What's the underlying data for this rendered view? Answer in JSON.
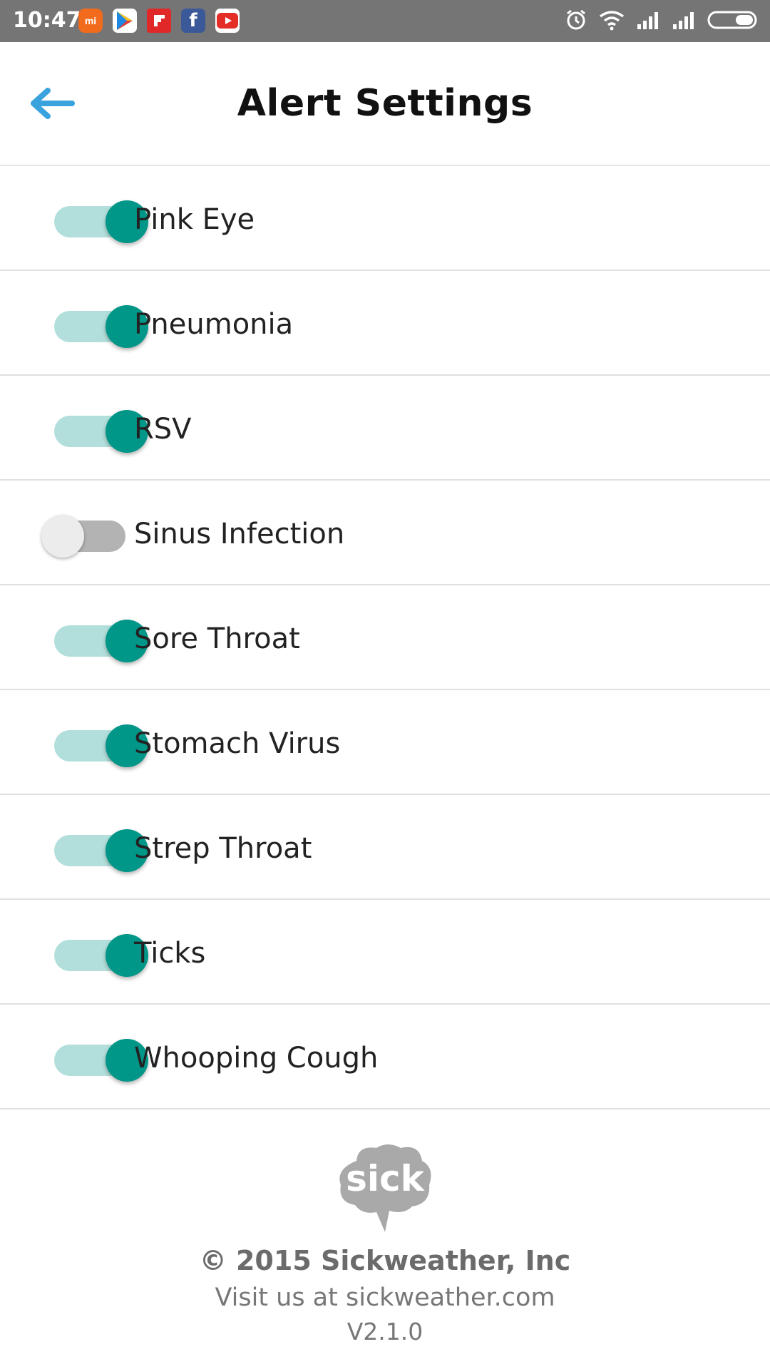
{
  "status_bar": {
    "time": "10:47",
    "notification_icons": [
      "mi-icon",
      "play-store-icon",
      "flipboard-icon",
      "facebook-icon",
      "youtube-icon"
    ],
    "system_icons": [
      "alarm-icon",
      "wifi-icon",
      "signal-icon",
      "signal-icon",
      "battery-icon"
    ]
  },
  "header": {
    "title": "Alert Settings",
    "back_icon": "arrow-left-icon",
    "accent_color": "#3aa3dd"
  },
  "alerts": [
    {
      "label": "Pink Eye",
      "enabled": true
    },
    {
      "label": "Pneumonia",
      "enabled": true
    },
    {
      "label": "RSV",
      "enabled": true
    },
    {
      "label": "Sinus Infection",
      "enabled": false
    },
    {
      "label": "Sore Throat",
      "enabled": true
    },
    {
      "label": "Stomach Virus",
      "enabled": true
    },
    {
      "label": "Strep Throat",
      "enabled": true
    },
    {
      "label": "Ticks",
      "enabled": true
    },
    {
      "label": "Whooping Cough",
      "enabled": true
    }
  ],
  "footer": {
    "logo_text": "sick",
    "copyright": "© 2015 Sickweather, Inc",
    "visit": "Visit us at sickweather.com",
    "version": "V2.1.0"
  },
  "colors": {
    "switch_on_thumb": "#009688",
    "switch_on_track": "#b2dfdb",
    "switch_off_thumb": "#ececec",
    "switch_off_track": "#b3b3b3",
    "status_bar": "#757575"
  }
}
